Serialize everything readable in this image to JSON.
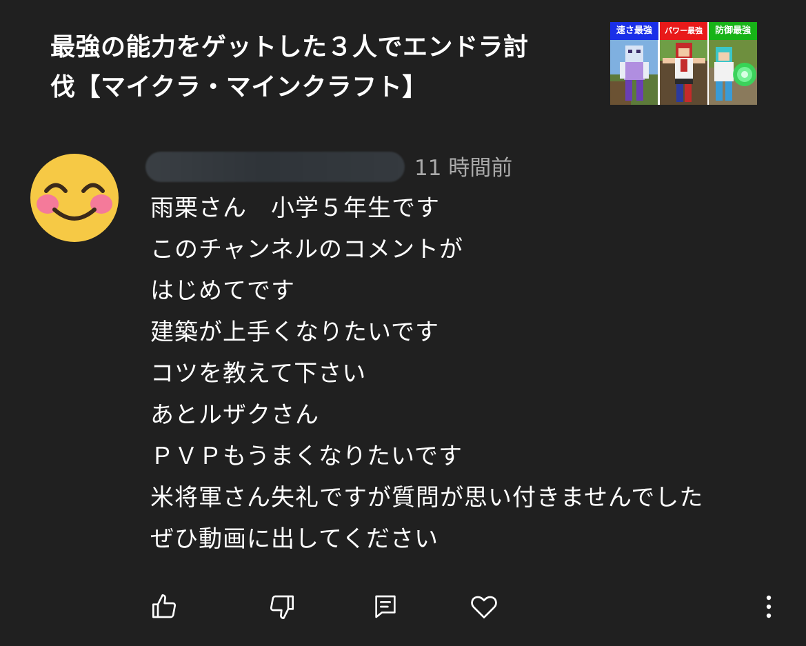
{
  "video": {
    "title_line1": "最強の能力をゲットした３人でエンドラ討",
    "title_line2": "伐【マイクラ・マインクラフト】",
    "thumbnail": {
      "panels": [
        {
          "label": "速さ最強",
          "color": "#1a2fe8"
        },
        {
          "label": "パワー最強",
          "color": "#e81a1a"
        },
        {
          "label": "防御最強",
          "color": "#17b317"
        }
      ]
    }
  },
  "comment": {
    "avatar_icon": "smiling-face-emoji",
    "timestamp": "11 時間前",
    "lines": [
      "雨栗さん　小学５年生です",
      "このチャンネルのコメントが",
      "はじめてです",
      "建築が上手くなりたいです",
      "コツを教えて下さい",
      "あとルザクさん",
      "ＰＶＰもうまくなりたいです",
      "米将軍さん失礼ですが質問が思い付きませんでした",
      "ぜひ動画に出してください"
    ]
  },
  "actions": {
    "like_icon": "thumbs-up-icon",
    "dislike_icon": "thumbs-down-icon",
    "reply_icon": "comment-icon",
    "heart_icon": "heart-icon",
    "more_icon": "more-vertical-icon"
  }
}
